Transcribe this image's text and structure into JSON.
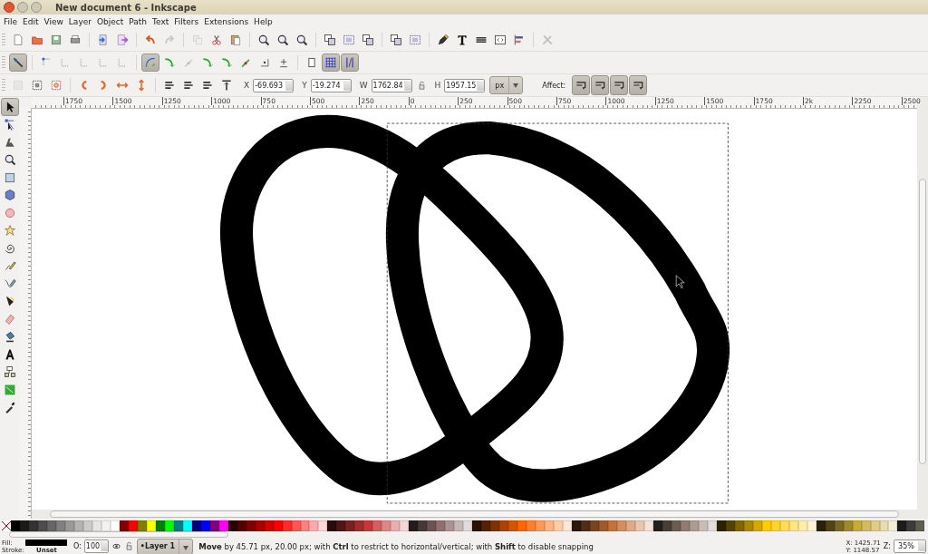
{
  "window": {
    "title": "New document 6 - Inkscape"
  },
  "menu": [
    "File",
    "Edit",
    "View",
    "Layer",
    "Object",
    "Path",
    "Text",
    "Filters",
    "Extensions",
    "Help"
  ],
  "commands_bar": [
    {
      "disabled": false
    },
    {
      "disabled": false
    },
    {
      "disabled": false
    },
    {
      "disabled": false
    },
    {
      "disabled": false
    },
    {
      "disabled": false
    },
    {
      "disabled": false
    },
    {
      "disabled": true
    },
    {
      "disabled": true
    },
    {
      "disabled": false
    },
    {
      "disabled": false
    },
    {
      "disabled": false
    },
    {
      "disabled": false
    },
    {
      "disabled": false
    },
    {
      "disabled": false
    },
    {
      "disabled": false
    },
    {
      "disabled": false
    },
    {
      "disabled": false
    },
    {
      "disabled": false
    },
    {
      "disabled": false
    },
    {
      "disabled": false
    },
    {
      "disabled": false
    },
    {
      "disabled": false
    },
    {
      "disabled": false
    },
    {
      "disabled": true
    }
  ],
  "snap_bar": [
    {
      "on": true,
      "disabled": false
    },
    {
      "on": false,
      "disabled": false
    },
    {
      "on": false,
      "disabled": true
    },
    {
      "on": false,
      "disabled": true
    },
    {
      "on": false,
      "disabled": true
    },
    {
      "on": false,
      "disabled": true
    },
    {
      "on": true,
      "disabled": false
    },
    {
      "on": false,
      "disabled": false
    },
    {
      "on": false,
      "disabled": true
    },
    {
      "on": false,
      "disabled": false
    },
    {
      "on": false,
      "disabled": false
    },
    {
      "on": false,
      "disabled": false
    },
    {
      "on": false,
      "disabled": false
    },
    {
      "on": false,
      "disabled": false
    },
    {
      "on": false,
      "disabled": false
    },
    {
      "on": true,
      "disabled": false
    },
    {
      "on": true,
      "disabled": false
    }
  ],
  "tool_controls": {
    "buttons": [
      {
        "disabled": true
      },
      {
        "disabled": false
      },
      {
        "disabled": false
      },
      {
        "disabled": false
      },
      {
        "disabled": false
      },
      {
        "disabled": false
      },
      {
        "disabled": false
      },
      {
        "disabled": false
      },
      {
        "disabled": false
      },
      {
        "disabled": false
      },
      {
        "disabled": false
      }
    ],
    "fields": [
      {
        "label": "X",
        "value": "-69.693"
      },
      {
        "label": "Y",
        "value": "-19.274"
      },
      {
        "label": "W",
        "value": "1762.84"
      },
      {
        "label": "H",
        "value": "1957.15"
      }
    ],
    "unit": "px",
    "affect_label": "Affect:",
    "affect": [
      {
        "on": true
      },
      {
        "on": true
      },
      {
        "on": true
      },
      {
        "on": true
      }
    ]
  },
  "ruler": {
    "labels": [
      "1750",
      "1500",
      "1250",
      "1000",
      "750",
      "500",
      "250",
      "0",
      "250",
      "500",
      "750",
      "1000",
      "1250",
      "1500",
      "1750",
      "2k",
      "2250",
      "2500"
    ]
  },
  "toolbox": [
    {
      "selected": true
    },
    {
      "selected": false
    },
    {
      "selected": false
    },
    {
      "selected": false
    },
    {
      "selected": false
    },
    {
      "selected": false
    },
    {
      "selected": false
    },
    {
      "selected": false
    },
    {
      "selected": false
    },
    {
      "selected": false
    },
    {
      "selected": false
    },
    {
      "selected": false
    },
    {
      "selected": false
    },
    {
      "selected": false
    },
    {
      "selected": false
    },
    {
      "selected": false
    },
    {
      "selected": false
    },
    {
      "selected": false
    }
  ],
  "palette": [
    {
      "color": "#000000"
    },
    {
      "color": "#1a1a1a"
    },
    {
      "color": "#333333"
    },
    {
      "color": "#4d4d4d"
    },
    {
      "color": "#666666"
    },
    {
      "color": "#808080"
    },
    {
      "color": "#999999"
    },
    {
      "color": "#b3b3b3"
    },
    {
      "color": "#cccccc"
    },
    {
      "color": "#e6e6e6"
    },
    {
      "color": "#f2f2f2"
    },
    {
      "color": "#ffffff"
    },
    {
      "color": "#800000"
    },
    {
      "color": "#ff0000"
    },
    {
      "color": "#808000"
    },
    {
      "color": "#ffff00"
    },
    {
      "color": "#008000"
    },
    {
      "color": "#00ff00"
    },
    {
      "color": "#008080"
    },
    {
      "color": "#00ffff"
    },
    {
      "color": "#000080"
    },
    {
      "color": "#0000ff"
    },
    {
      "color": "#800080"
    },
    {
      "color": "#ff00ff"
    },
    {
      "color": "#2b0000"
    },
    {
      "color": "#550000"
    },
    {
      "color": "#800000"
    },
    {
      "color": "#aa0000"
    },
    {
      "color": "#d40000"
    },
    {
      "color": "#ff0000"
    },
    {
      "color": "#ff2a2a"
    },
    {
      "color": "#ff5555"
    },
    {
      "color": "#ff8080"
    },
    {
      "color": "#ffaaaa"
    },
    {
      "color": "#ffd5d5"
    },
    {
      "color": "#280b0b"
    },
    {
      "color": "#501616"
    },
    {
      "color": "#782121"
    },
    {
      "color": "#a02c2c"
    },
    {
      "color": "#c83737"
    },
    {
      "color": "#d35f5f"
    },
    {
      "color": "#de8787"
    },
    {
      "color": "#e9afaf"
    },
    {
      "color": "#f4d7d7"
    },
    {
      "color": "#241c1c"
    },
    {
      "color": "#483737"
    },
    {
      "color": "#6c5353"
    },
    {
      "color": "#916f6f"
    },
    {
      "color": "#ac9393"
    },
    {
      "color": "#c8b7b7"
    },
    {
      "color": "#e3dbdb"
    },
    {
      "color": "#2b1100"
    },
    {
      "color": "#552200"
    },
    {
      "color": "#803300"
    },
    {
      "color": "#aa4400"
    },
    {
      "color": "#d45500"
    },
    {
      "color": "#ff6600"
    },
    {
      "color": "#ff7f2a"
    },
    {
      "color": "#ff9955"
    },
    {
      "color": "#ffb380"
    },
    {
      "color": "#ffccaa"
    },
    {
      "color": "#ffe6d5"
    },
    {
      "color": "#28170b"
    },
    {
      "color": "#502d16"
    },
    {
      "color": "#784421"
    },
    {
      "color": "#a05a2c"
    },
    {
      "color": "#c87137"
    },
    {
      "color": "#d38d5f"
    },
    {
      "color": "#deaa87"
    },
    {
      "color": "#e9c6af"
    },
    {
      "color": "#f4e3d7"
    },
    {
      "color": "#241f1c"
    },
    {
      "color": "#483e37"
    },
    {
      "color": "#6c5d53"
    },
    {
      "color": "#917c6f"
    },
    {
      "color": "#ac9d93"
    },
    {
      "color": "#c8beb7"
    },
    {
      "color": "#e3dedb"
    },
    {
      "color": "#2b2200"
    },
    {
      "color": "#554400"
    },
    {
      "color": "#806600"
    },
    {
      "color": "#aa8800"
    },
    {
      "color": "#d4aa00"
    },
    {
      "color": "#ffcc00"
    },
    {
      "color": "#ffd42a"
    },
    {
      "color": "#ffdd55"
    },
    {
      "color": "#ffe680"
    },
    {
      "color": "#ffeeaa"
    },
    {
      "color": "#fff6d5"
    },
    {
      "color": "#28220b"
    },
    {
      "color": "#504416"
    },
    {
      "color": "#786721"
    },
    {
      "color": "#a0892c"
    },
    {
      "color": "#c8ab37"
    },
    {
      "color": "#d3bc5f"
    },
    {
      "color": "#decd87"
    },
    {
      "color": "#e9ddaf"
    },
    {
      "color": "#f4eed7"
    },
    {
      "color": "#1c1c1c"
    },
    {
      "color": "#3c3c3c"
    },
    {
      "color": "#5e5e50"
    }
  ],
  "status_bar": {
    "fill_label": "Fill:",
    "stroke_label": "Stroke:",
    "stroke_value": "Unset",
    "opacity_label": "O:",
    "opacity_value": "100",
    "layer": "•Layer 1",
    "message": "**Move** by 45.71 px, 20.00 px; with **Ctrl** to restrict to horizontal/vertical; with **Shift** to disable snapping",
    "cursor_x": "X: 1425.71",
    "cursor_y": "Y: 1148.57",
    "zoom_label": "Z:",
    "zoom_value": "35%"
  }
}
